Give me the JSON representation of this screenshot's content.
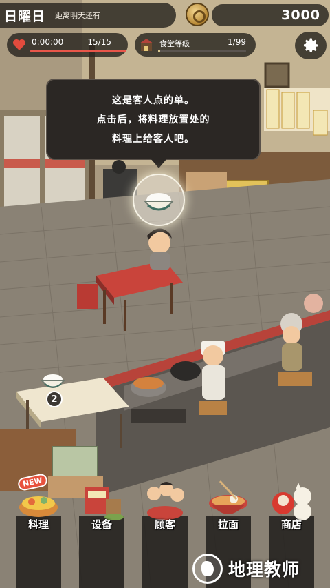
{
  "hud": {
    "day": "日曜日",
    "day_subtitle": "距离明天还有",
    "coins": "3000",
    "stamina": {
      "timer": "0:00:00",
      "count": "15/15",
      "fill": 1.0
    },
    "restaurant": {
      "label": "食堂等级",
      "count": "1/99",
      "fill": 0.02
    },
    "settings_icon": "gear-icon"
  },
  "tutorial": {
    "lines": [
      "这是客人点的单。",
      "点击后，将料理放置处的",
      "料理上给客人吧。"
    ]
  },
  "prep_counter": {
    "dish_count": "2"
  },
  "menu": [
    {
      "label": "料理",
      "icon": "cooking-icon",
      "badge": "NEW"
    },
    {
      "label": "设备",
      "icon": "equipment-icon"
    },
    {
      "label": "顾客",
      "icon": "customers-icon"
    },
    {
      "label": "拉面",
      "icon": "ramen-icon"
    },
    {
      "label": "商店",
      "icon": "shop-icon"
    }
  ],
  "watermark": {
    "text": "地理教师"
  },
  "colors": {
    "hud_bg": "#28241f",
    "stamina": "#e8564a",
    "floor": "#8a8275",
    "counter_red": "#b8433a"
  }
}
